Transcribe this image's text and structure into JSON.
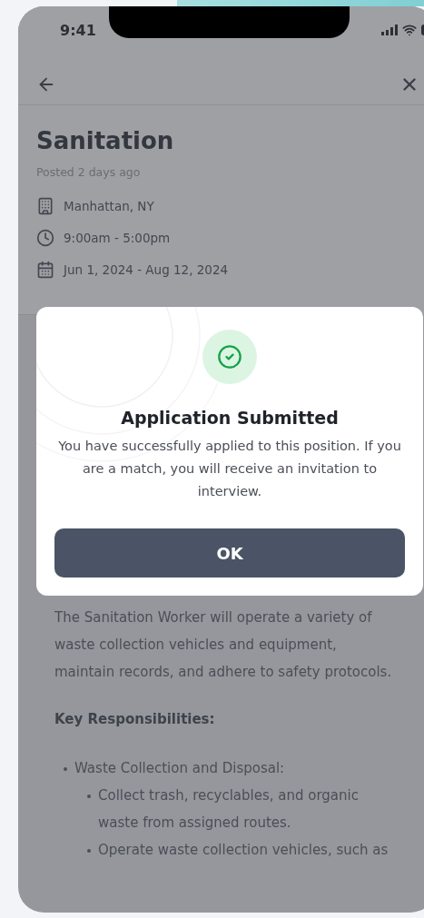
{
  "status_bar": {
    "time": "9:41"
  },
  "job": {
    "title": "Sanitation",
    "posted": "Posted 2 days ago",
    "details": [
      {
        "kind": "location",
        "text": "Manhattan, NY"
      },
      {
        "kind": "hours",
        "text": "9:00am - 5:00pm"
      },
      {
        "kind": "dates",
        "text": "Jun 1, 2024 - Aug 12, 2024"
      }
    ]
  },
  "description": {
    "paragraph": "The Sanitation Worker will operate a variety of waste collection vehicles and equipment, maintain records, and adhere to safety protocols.",
    "heading": "Key Responsibilities:",
    "list": [
      {
        "text": "Waste Collection and Disposal:",
        "children": [
          {
            "text": "Collect trash, recyclables, and organic waste from assigned routes."
          },
          {
            "text": "Operate waste collection vehicles, such as"
          }
        ]
      }
    ]
  },
  "dialog": {
    "title": "Application Submitted",
    "message": "You have successfully applied to this position. If you are a match, you will receive an invitation to interview.",
    "button": "OK"
  }
}
